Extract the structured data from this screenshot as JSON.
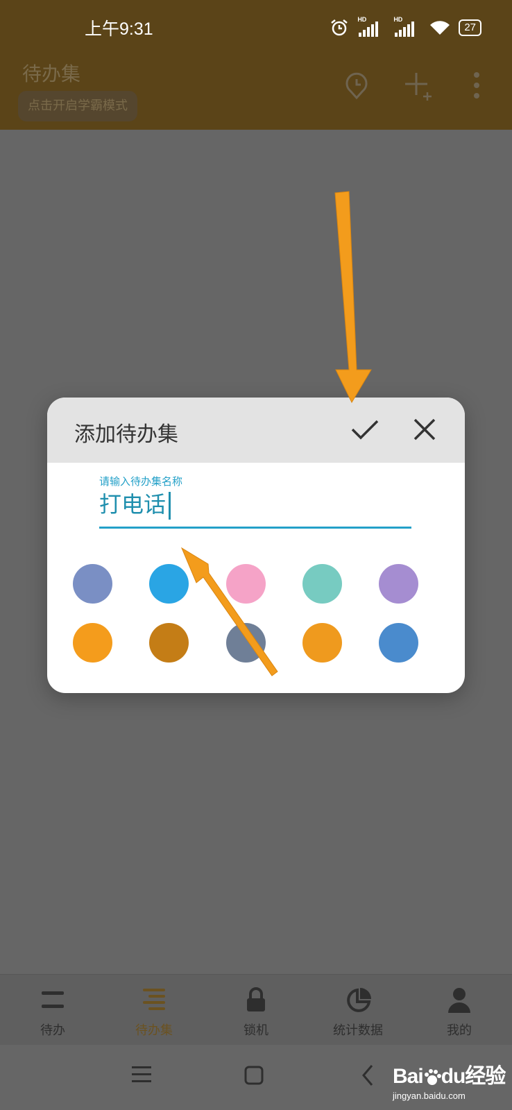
{
  "status_bar": {
    "time": "上午9:31",
    "hd1": "HD",
    "hd2": "HD",
    "battery": "27"
  },
  "app": {
    "title": "待办集",
    "mode_button": "点击开启学霸模式"
  },
  "dialog": {
    "title": "添加待办集",
    "input_label": "请输入待办集名称",
    "input_value": "打电话",
    "colors": [
      "#7a8fc4",
      "#2aa5e4",
      "#f5a3c7",
      "#77cbc1",
      "#a58dd1",
      "#f49c1c",
      "#c47d16",
      "#6f7f97",
      "#ef9a1e",
      "#4a8bcd"
    ]
  },
  "bottom_nav": [
    {
      "label": "待办",
      "icon": "list-icon"
    },
    {
      "label": "待办集",
      "icon": "list-set-icon",
      "active": true
    },
    {
      "label": "锁机",
      "icon": "lock-icon"
    },
    {
      "label": "统计数据",
      "icon": "pie-chart-icon"
    },
    {
      "label": "我的",
      "icon": "person-icon"
    }
  ],
  "watermark": {
    "brand_left": "Bai",
    "brand_mid": "du",
    "brand_right": "经验",
    "url": "jingyan.baidu.com"
  },
  "annotation_color": "#f39c1c"
}
